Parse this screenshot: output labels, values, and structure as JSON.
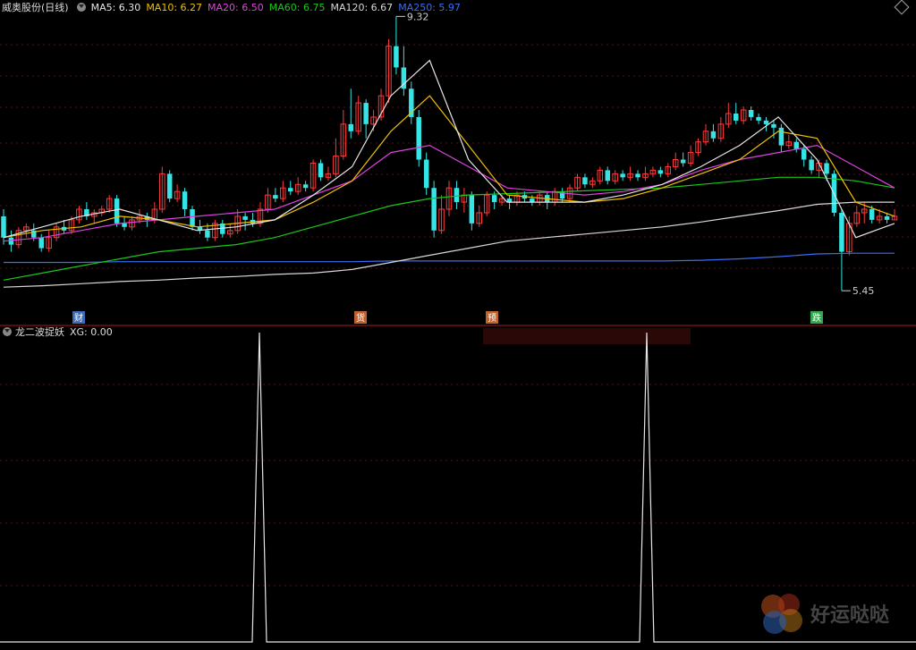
{
  "header": {
    "stock_name": "威奥股份(日线)",
    "ma_items": [
      {
        "label": "MA5: 6.30",
        "color": "#e6e6e6"
      },
      {
        "label": "MA10: 6.27",
        "color": "#f0c000"
      },
      {
        "label": "MA20: 6.50",
        "color": "#e040e0"
      },
      {
        "label": "MA60: 6.75",
        "color": "#19c819"
      },
      {
        "label": "MA120: 6.67",
        "color": "#d8d8d8"
      },
      {
        "label": "MA250: 5.97",
        "color": "#3a6df0"
      }
    ]
  },
  "sub_header": {
    "indicator": "龙二波捉妖",
    "value": "XG: 0.00"
  },
  "markers": [
    {
      "label": "财",
      "color": "#3a6ab8"
    },
    {
      "label": "货",
      "color": "#c0602a"
    },
    {
      "label": "预",
      "color": "#c0602a"
    },
    {
      "label": "跌",
      "color": "#2ea84a"
    }
  ],
  "watermark": {
    "text": "好运哒哒"
  },
  "chart_data": {
    "type": "candlestick",
    "high_label": "9.32",
    "low_label": "5.45",
    "price_range": [
      5.2,
      9.4
    ],
    "colors": {
      "up": "#ff3b3b",
      "down": "#35e4e4",
      "ma5": "#e6e6e6",
      "ma10": "#f0c000",
      "ma20": "#e040e0",
      "ma60": "#19c819",
      "ma120": "#d8d8d8",
      "ma250": "#3a6df0"
    },
    "candles": [
      [
        6.5,
        6.2,
        6.6,
        6.1
      ],
      [
        6.2,
        6.1,
        6.3,
        6.0
      ],
      [
        6.1,
        6.3,
        6.35,
        6.05
      ],
      [
        6.3,
        6.35,
        6.4,
        6.2
      ],
      [
        6.3,
        6.2,
        6.4,
        6.15
      ],
      [
        6.2,
        6.05,
        6.25,
        6.0
      ],
      [
        6.05,
        6.2,
        6.3,
        6.0
      ],
      [
        6.2,
        6.35,
        6.4,
        6.15
      ],
      [
        6.35,
        6.3,
        6.45,
        6.25
      ],
      [
        6.3,
        6.45,
        6.5,
        6.25
      ],
      [
        6.45,
        6.6,
        6.65,
        6.4
      ],
      [
        6.6,
        6.5,
        6.7,
        6.45
      ],
      [
        6.5,
        6.55,
        6.6,
        6.4
      ],
      [
        6.55,
        6.6,
        6.65,
        6.5
      ],
      [
        6.6,
        6.75,
        6.8,
        6.55
      ],
      [
        6.75,
        6.4,
        6.8,
        6.35
      ],
      [
        6.4,
        6.35,
        6.5,
        6.3
      ],
      [
        6.35,
        6.45,
        6.5,
        6.3
      ],
      [
        6.45,
        6.5,
        6.6,
        6.4
      ],
      [
        6.5,
        6.45,
        6.55,
        6.35
      ],
      [
        6.45,
        6.6,
        6.7,
        6.4
      ],
      [
        6.6,
        7.1,
        7.2,
        6.55
      ],
      [
        7.1,
        6.75,
        7.15,
        6.7
      ],
      [
        6.75,
        6.85,
        6.95,
        6.7
      ],
      [
        6.85,
        6.6,
        6.9,
        6.5
      ],
      [
        6.6,
        6.35,
        6.65,
        6.3
      ],
      [
        6.35,
        6.3,
        6.45,
        6.25
      ],
      [
        6.3,
        6.2,
        6.4,
        6.15
      ],
      [
        6.2,
        6.4,
        6.45,
        6.15
      ],
      [
        6.4,
        6.25,
        6.45,
        6.2
      ],
      [
        6.25,
        6.3,
        6.4,
        6.2
      ],
      [
        6.3,
        6.5,
        6.6,
        6.25
      ],
      [
        6.5,
        6.45,
        6.55,
        6.3
      ],
      [
        6.45,
        6.4,
        6.55,
        6.35
      ],
      [
        6.4,
        6.6,
        6.7,
        6.35
      ],
      [
        6.6,
        6.8,
        6.9,
        6.55
      ],
      [
        6.8,
        6.75,
        6.9,
        6.7
      ],
      [
        6.75,
        6.9,
        7.0,
        6.7
      ],
      [
        6.9,
        6.85,
        7.0,
        6.8
      ],
      [
        6.85,
        6.95,
        7.05,
        6.8
      ],
      [
        6.95,
        6.9,
        7.0,
        6.85
      ],
      [
        6.9,
        7.25,
        7.3,
        6.85
      ],
      [
        7.25,
        7.05,
        7.3,
        7.0
      ],
      [
        7.05,
        7.1,
        7.2,
        7.0
      ],
      [
        7.1,
        7.35,
        7.6,
        7.05
      ],
      [
        7.35,
        7.8,
        8.0,
        7.3
      ],
      [
        7.8,
        7.7,
        8.3,
        7.6
      ],
      [
        7.7,
        8.1,
        8.2,
        7.65
      ],
      [
        8.1,
        7.8,
        8.15,
        7.6
      ],
      [
        7.8,
        7.9,
        8.0,
        7.7
      ],
      [
        7.9,
        8.2,
        8.3,
        7.85
      ],
      [
        8.2,
        8.9,
        9.0,
        8.1
      ],
      [
        8.9,
        8.6,
        9.32,
        8.5
      ],
      [
        8.6,
        8.3,
        8.9,
        8.2
      ],
      [
        8.3,
        7.9,
        8.4,
        7.8
      ],
      [
        7.9,
        7.3,
        8.0,
        7.2
      ],
      [
        7.3,
        6.9,
        7.4,
        6.8
      ],
      [
        6.9,
        6.3,
        7.0,
        6.2
      ],
      [
        6.3,
        6.6,
        6.8,
        6.25
      ],
      [
        6.6,
        6.9,
        7.0,
        6.5
      ],
      [
        6.9,
        6.7,
        7.0,
        6.6
      ],
      [
        6.7,
        6.8,
        6.9,
        6.55
      ],
      [
        6.8,
        6.4,
        6.85,
        6.3
      ],
      [
        6.4,
        6.55,
        6.65,
        6.35
      ],
      [
        6.55,
        6.8,
        6.85,
        6.5
      ],
      [
        6.8,
        6.7,
        6.85,
        6.6
      ],
      [
        6.7,
        6.75,
        6.8,
        6.65
      ],
      [
        6.75,
        6.7,
        6.8,
        6.6
      ],
      [
        6.7,
        6.8,
        6.85,
        6.65
      ],
      [
        6.8,
        6.75,
        6.85,
        6.7
      ],
      [
        6.75,
        6.7,
        6.8,
        6.65
      ],
      [
        6.7,
        6.8,
        6.85,
        6.65
      ],
      [
        6.8,
        6.7,
        6.85,
        6.6
      ],
      [
        6.7,
        6.85,
        6.9,
        6.65
      ],
      [
        6.85,
        6.75,
        6.9,
        6.7
      ],
      [
        6.75,
        6.9,
        6.95,
        6.7
      ],
      [
        6.9,
        7.05,
        7.1,
        6.85
      ],
      [
        7.05,
        6.95,
        7.1,
        6.9
      ],
      [
        6.95,
        7.0,
        7.05,
        6.9
      ],
      [
        7.0,
        7.15,
        7.2,
        6.95
      ],
      [
        7.15,
        7.0,
        7.2,
        6.95
      ],
      [
        7.0,
        7.1,
        7.15,
        6.95
      ],
      [
        7.1,
        7.05,
        7.15,
        7.0
      ],
      [
        7.05,
        7.1,
        7.2,
        7.0
      ],
      [
        7.1,
        7.05,
        7.15,
        7.0
      ],
      [
        7.05,
        7.1,
        7.2,
        7.0
      ],
      [
        7.1,
        7.15,
        7.2,
        7.05
      ],
      [
        7.15,
        7.1,
        7.2,
        7.05
      ],
      [
        7.1,
        7.2,
        7.25,
        7.05
      ],
      [
        7.2,
        7.3,
        7.4,
        7.15
      ],
      [
        7.3,
        7.25,
        7.4,
        7.2
      ],
      [
        7.25,
        7.4,
        7.5,
        7.2
      ],
      [
        7.4,
        7.55,
        7.6,
        7.35
      ],
      [
        7.55,
        7.7,
        7.8,
        7.5
      ],
      [
        7.7,
        7.6,
        7.8,
        7.55
      ],
      [
        7.6,
        7.8,
        7.9,
        7.55
      ],
      [
        7.8,
        7.95,
        8.1,
        7.75
      ],
      [
        7.95,
        7.85,
        8.1,
        7.8
      ],
      [
        7.85,
        8.0,
        8.05,
        7.8
      ],
      [
        8.0,
        7.9,
        8.05,
        7.85
      ],
      [
        7.9,
        7.85,
        7.95,
        7.8
      ],
      [
        7.85,
        7.8,
        7.9,
        7.7
      ],
      [
        7.8,
        7.75,
        7.85,
        7.6
      ],
      [
        7.75,
        7.5,
        7.8,
        7.4
      ],
      [
        7.5,
        7.55,
        7.65,
        7.45
      ],
      [
        7.55,
        7.45,
        7.6,
        7.4
      ],
      [
        7.45,
        7.3,
        7.5,
        7.2
      ],
      [
        7.3,
        7.15,
        7.35,
        7.1
      ],
      [
        7.15,
        7.25,
        7.3,
        7.05
      ],
      [
        7.25,
        7.1,
        7.3,
        7.0
      ],
      [
        7.1,
        6.55,
        7.15,
        6.5
      ],
      [
        6.55,
        6.0,
        6.6,
        5.45
      ],
      [
        6.0,
        6.4,
        6.5,
        5.95
      ],
      [
        6.4,
        6.55,
        6.65,
        6.35
      ],
      [
        6.55,
        6.6,
        6.7,
        6.4
      ],
      [
        6.6,
        6.45,
        6.65,
        6.4
      ],
      [
        6.45,
        6.5,
        6.6,
        6.4
      ],
      [
        6.5,
        6.45,
        6.55,
        6.4
      ],
      [
        6.45,
        6.5,
        6.6,
        6.45
      ]
    ],
    "ma_series": {
      "ma250": [
        5.85,
        5.85,
        5.85,
        5.86,
        5.86,
        5.86,
        5.86,
        5.86,
        5.86,
        5.86,
        5.87,
        5.87,
        5.87,
        5.87,
        5.87,
        5.87,
        5.87,
        5.87,
        5.88,
        5.9,
        5.93,
        5.97,
        5.98,
        5.98
      ],
      "ma120": [
        5.5,
        5.52,
        5.55,
        5.58,
        5.6,
        5.63,
        5.65,
        5.68,
        5.7,
        5.75,
        5.85,
        5.95,
        6.05,
        6.15,
        6.2,
        6.25,
        6.3,
        6.35,
        6.42,
        6.5,
        6.58,
        6.67,
        6.7,
        6.7
      ],
      "ma60": [
        5.6,
        5.7,
        5.8,
        5.9,
        6.0,
        6.05,
        6.1,
        6.2,
        6.35,
        6.5,
        6.65,
        6.75,
        6.8,
        6.82,
        6.84,
        6.86,
        6.88,
        6.9,
        6.95,
        7.0,
        7.05,
        7.05,
        7.0,
        6.9
      ],
      "ma20": [
        6.15,
        6.2,
        6.3,
        6.4,
        6.45,
        6.5,
        6.55,
        6.6,
        6.8,
        7.0,
        7.4,
        7.5,
        7.2,
        6.9,
        6.85,
        6.8,
        6.85,
        6.95,
        7.15,
        7.3,
        7.4,
        7.5,
        7.2,
        6.9
      ],
      "ma10": [
        6.2,
        6.3,
        6.35,
        6.5,
        6.45,
        6.35,
        6.4,
        6.45,
        6.7,
        7.0,
        7.7,
        8.2,
        7.5,
        6.8,
        6.75,
        6.7,
        6.75,
        6.9,
        7.1,
        7.3,
        7.7,
        7.6,
        6.7,
        6.5
      ],
      "ma5": [
        6.2,
        6.35,
        6.5,
        6.6,
        6.45,
        6.3,
        6.35,
        6.45,
        6.8,
        7.2,
        8.2,
        8.7,
        7.3,
        6.7,
        6.7,
        6.7,
        6.8,
        6.95,
        7.2,
        7.5,
        7.9,
        7.3,
        6.2,
        6.4
      ]
    },
    "markers_x": [
      88,
      403,
      550,
      913
    ],
    "signal": {
      "type": "line",
      "spikes_at_x": [
        290,
        723
      ],
      "values": [
        1,
        1
      ],
      "baseline": 0
    }
  }
}
